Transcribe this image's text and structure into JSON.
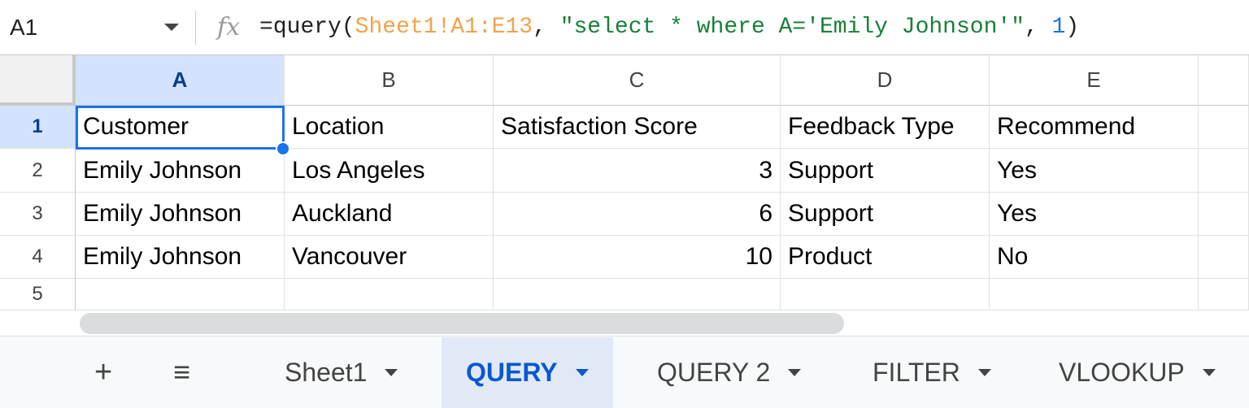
{
  "formula_bar": {
    "name_box": "A1",
    "fx_label": "fx",
    "formula": {
      "prefix": "=query(",
      "range": "Sheet1!A1:E13",
      "comma1": ", ",
      "query": "\"select * where A='Emily Johnson'\"",
      "comma2": ", ",
      "headers": "1",
      "suffix": ")"
    }
  },
  "columns": [
    "A",
    "B",
    "C",
    "D",
    "E"
  ],
  "rows": [
    {
      "n": "1",
      "cells": [
        "Customer",
        "Location",
        "Satisfaction Score",
        "Feedback Type",
        "Recommend"
      ]
    },
    {
      "n": "2",
      "cells": [
        "Emily Johnson",
        "Los Angeles",
        "3",
        "Support",
        "Yes"
      ]
    },
    {
      "n": "3",
      "cells": [
        "Emily Johnson",
        "Auckland",
        "6",
        "Support",
        "Yes"
      ]
    },
    {
      "n": "4",
      "cells": [
        "Emily Johnson",
        "Vancouver",
        "10",
        "Product",
        "No"
      ]
    },
    {
      "n": "5",
      "cells": [
        "",
        "",
        "",
        "",
        ""
      ]
    }
  ],
  "tabs": {
    "add": "+",
    "all": "≡",
    "items": [
      "Sheet1",
      "QUERY",
      "QUERY 2",
      "FILTER",
      "VLOOKUP"
    ],
    "active": "QUERY"
  },
  "colors": {
    "accent": "#1a73e8",
    "selected_header": "#d3e3fd"
  }
}
